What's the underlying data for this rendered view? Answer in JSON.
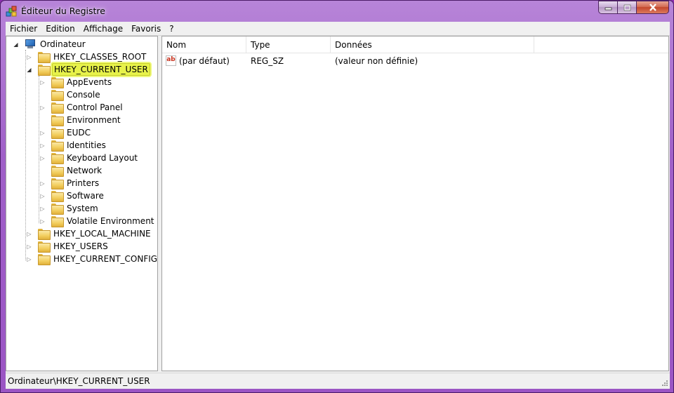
{
  "window": {
    "title": "Éditeur du Registre",
    "accent": "#a060c8"
  },
  "menu": [
    "Fichier",
    "Edition",
    "Affichage",
    "Favoris",
    "?"
  ],
  "tree": {
    "root": "Ordinateur",
    "hives": [
      {
        "label": "HKEY_CLASSES_ROOT",
        "expander": "▷"
      },
      {
        "label": "HKEY_CURRENT_USER",
        "expander": "◢",
        "selected": true
      },
      {
        "label": "HKEY_LOCAL_MACHINE",
        "expander": "▷"
      },
      {
        "label": "HKEY_USERS",
        "expander": "▷"
      },
      {
        "label": "HKEY_CURRENT_CONFIG",
        "expander": "▷"
      }
    ],
    "current_user_children": [
      {
        "label": "AppEvents",
        "expander": "▷"
      },
      {
        "label": "Console",
        "expander": ""
      },
      {
        "label": "Control Panel",
        "expander": "▷"
      },
      {
        "label": "Environment",
        "expander": ""
      },
      {
        "label": "EUDC",
        "expander": "▷"
      },
      {
        "label": "Identities",
        "expander": "▷"
      },
      {
        "label": "Keyboard Layout",
        "expander": "▷"
      },
      {
        "label": "Network",
        "expander": ""
      },
      {
        "label": "Printers",
        "expander": "▷"
      },
      {
        "label": "Software",
        "expander": "▷"
      },
      {
        "label": "System",
        "expander": "▷"
      },
      {
        "label": "Volatile Environment",
        "expander": "▷"
      }
    ]
  },
  "list": {
    "columns": [
      "Nom",
      "Type",
      "Données"
    ],
    "rows": [
      {
        "icon": "ab",
        "name": "(par défaut)",
        "type": "REG_SZ",
        "data": "(valeur non définie)"
      }
    ]
  },
  "statusbar": {
    "path": "Ordinateur\\HKEY_CURRENT_USER"
  }
}
